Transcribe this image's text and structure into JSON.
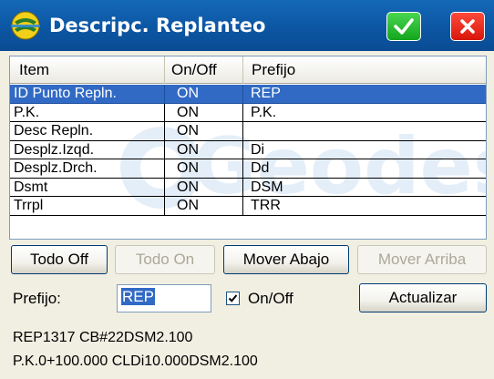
{
  "window": {
    "title": "Descripc. Replanteo",
    "title_color": "#ffffff",
    "titlebar_color": "#0c56a3"
  },
  "titlebar_buttons": {
    "ok_icon": "checkmark-icon",
    "close_icon": "close-x-icon",
    "ok_color": "#14a51d",
    "close_color": "#d8160a"
  },
  "list": {
    "watermark_text": "Geodes",
    "columns": [
      "Item",
      "On/Off",
      "Prefijo"
    ],
    "rows": [
      {
        "item": "ID Punto Repln.",
        "state": "ON",
        "prefix": "REP",
        "selected": true
      },
      {
        "item": "P.K.",
        "state": "ON",
        "prefix": "P.K.",
        "selected": false
      },
      {
        "item": "Desc Repln.",
        "state": "ON",
        "prefix": "",
        "selected": false
      },
      {
        "item": "Desplz.Izqd.",
        "state": "ON",
        "prefix": "Di",
        "selected": false
      },
      {
        "item": "Desplz.Drch.",
        "state": "ON",
        "prefix": "Dd",
        "selected": false
      },
      {
        "item": "Dsmt",
        "state": "ON",
        "prefix": "DSM",
        "selected": false
      },
      {
        "item": "Trrpl",
        "state": "ON",
        "prefix": "TRR",
        "selected": false
      }
    ],
    "selection_color": "#316ac5"
  },
  "buttons": {
    "todo_off": "Todo Off",
    "todo_on": "Todo On",
    "mover_abajo": "Mover Abajo",
    "mover_arriba": "Mover Arriba",
    "actualizar": "Actualizar"
  },
  "form": {
    "prefijo_label": "Prefijo:",
    "prefijo_value": "REP",
    "onoff_label": "On/Off",
    "onoff_checked": true
  },
  "preview": {
    "line1": "REP1317 CB#22DSM2.100",
    "line2": "P.K.0+100.000 CLDi10.000DSM2.100"
  }
}
